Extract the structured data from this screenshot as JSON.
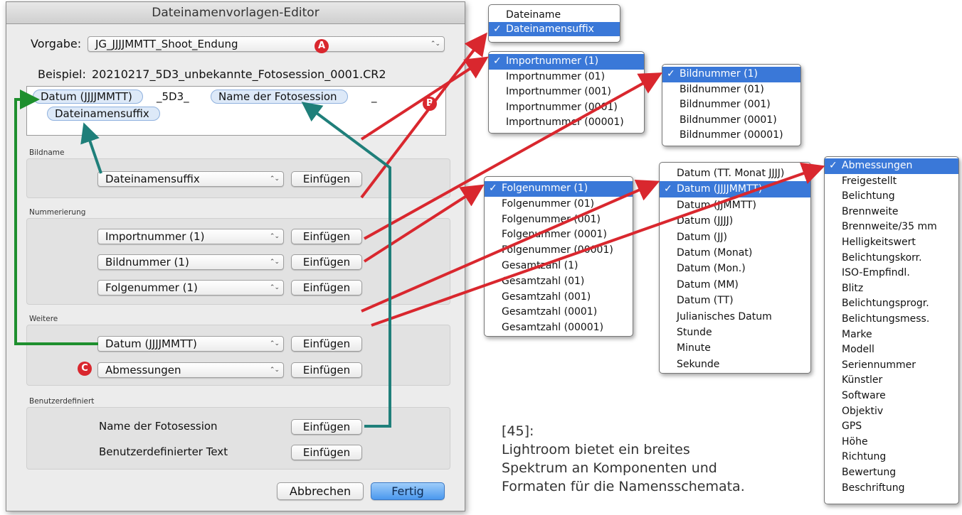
{
  "window": {
    "title": "Dateinamenvorlagen-Editor"
  },
  "preset": {
    "label": "Vorgabe:",
    "value": "JG_JJJJMMTT_Shoot_Endung"
  },
  "example": {
    "label": "Beispiel:",
    "value": "20210217_5D3_unbekannte_Fotosession_0001.CR2"
  },
  "tokens": {
    "t1": "Datum (JJJJMMTT)",
    "sep1": "_5D3_",
    "t2": "Name der Fotosession",
    "sep2": "_",
    "t3": "Dateinamensuffix"
  },
  "badges": {
    "a": "A",
    "b": "B",
    "c": "C"
  },
  "sections": {
    "bildname": {
      "title": "Bildname",
      "select": "Dateinamensuffix"
    },
    "nummerierung": {
      "title": "Nummerierung",
      "select1": "Importnummer (1)",
      "select2": "Bildnummer (1)",
      "select3": "Folgenummer (1)"
    },
    "weitere": {
      "title": "Weitere",
      "select1": "Datum (JJJJMMTT)",
      "select2": "Abmessungen"
    },
    "benutzerdefiniert": {
      "title": "Benutzerdefiniert",
      "label1": "Name der Fotosession",
      "label2": "Benutzerdefinierter Text"
    }
  },
  "buttons": {
    "insert": "Einfügen",
    "cancel": "Abbrechen",
    "done": "Fertig"
  },
  "menus": {
    "check": "✓",
    "suffix": [
      "Dateiname",
      "Dateinamensuffix"
    ],
    "import": [
      "Importnummer (1)",
      "Importnummer (01)",
      "Importnummer (001)",
      "Importnummer (0001)",
      "Importnummer (00001)"
    ],
    "bild": [
      "Bildnummer (1)",
      "Bildnummer (01)",
      "Bildnummer (001)",
      "Bildnummer (0001)",
      "Bildnummer (00001)"
    ],
    "folge": [
      "Folgenummer (1)",
      "Folgenummer (01)",
      "Folgenummer (001)",
      "Folgenummer (0001)",
      "Folgenummer (00001)",
      "Gesamtzahl (1)",
      "Gesamtzahl (01)",
      "Gesamtzahl (001)",
      "Gesamtzahl (0001)",
      "Gesamtzahl (00001)"
    ],
    "datum": [
      "Datum (TT. Monat JJJJ)",
      "Datum (JJJJMMTT)",
      "Datum (JJMMTT)",
      "Datum (JJJJ)",
      "Datum (JJ)",
      "Datum (Monat)",
      "Datum (Mon.)",
      "Datum (MM)",
      "Datum (TT)",
      "Julianisches Datum",
      "Stunde",
      "Minute",
      "Sekunde"
    ],
    "abm": [
      "Abmessungen",
      "Freigestellt",
      "Belichtung",
      "Brennweite",
      "Brennweite/35 mm",
      "Helligkeitswert",
      "Belichtungskorr.",
      "ISO-Empfindl.",
      "Blitz",
      "Belichtungsprogr.",
      "Belichtungsmess.",
      "Marke",
      "Modell",
      "Seriennummer",
      "Künstler",
      "Software",
      "Objektiv",
      "GPS",
      "Höhe",
      "Richtung",
      "Bewertung",
      "Beschriftung"
    ]
  },
  "caption": {
    "ref": "[45]:",
    "line1": "Lightroom bietet ein breites",
    "line2": "Spektrum an Komponenten und",
    "line3": "Formaten für die Namensschemata."
  },
  "colors": {
    "select_highlight": "#3a78d8",
    "badge": "#d9272e",
    "arrow_red": "#d9272e",
    "arrow_teal": "#1f7f7a",
    "arrow_green": "#1e8f2e"
  }
}
